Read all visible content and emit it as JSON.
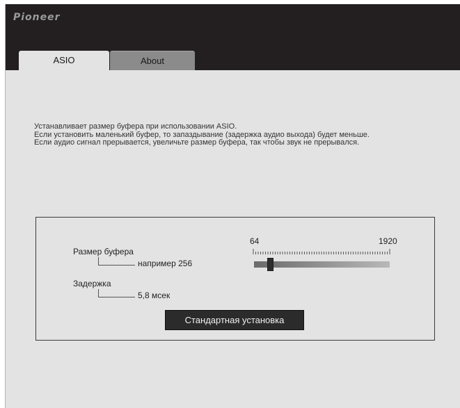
{
  "header": {
    "logo_text": "Pioneer"
  },
  "tabs": [
    {
      "label": "ASIO",
      "active": true
    },
    {
      "label": "About",
      "active": false
    }
  ],
  "description": {
    "line1": "Устанавливает размер буфера при использовании ASIO.",
    "line2": "Если установить маленький буфер, то запаздывание (задержка аудио выхода) будет меньше.",
    "line3": "Если аудио сигнал прерывается, увеличьте размер буфера, так чтобы звук не прерывался."
  },
  "buffer": {
    "label": "Размер буфера",
    "value_text": "например 256",
    "slider_min": "64",
    "slider_max": "1920",
    "slider_value": 256
  },
  "latency": {
    "label": "Задержка",
    "value_text": "5,8 мсек"
  },
  "default_button_label": "Стандартная установка",
  "colors": {
    "header_bg": "#231f20",
    "body_bg": "#e3e3e3",
    "button_bg": "#2b2b2b"
  }
}
